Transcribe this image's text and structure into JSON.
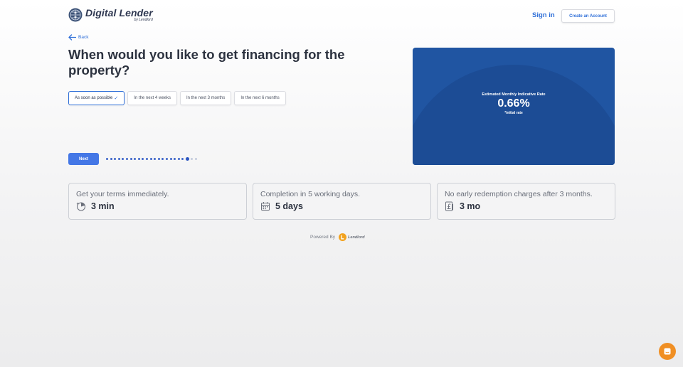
{
  "header": {
    "brand_title": "Digital Lender",
    "brand_sub": "by Lendlord",
    "signin_label": "Sign in",
    "create_account_label": "Create an Account"
  },
  "back_label": "Back",
  "question": "When would you like to get financing for the property?",
  "options": [
    {
      "label": "As soon as possible",
      "selected": true
    },
    {
      "label": "In the next 4 weeks",
      "selected": false
    },
    {
      "label": "In the next 3 months",
      "selected": false
    },
    {
      "label": "In the next 6 months",
      "selected": false
    }
  ],
  "next_label": "Next",
  "progress": {
    "total": 23,
    "current": 21
  },
  "rate_panel": {
    "label": "Estimated Monthly Indicative Rate",
    "value": "0.66%",
    "note": "*initial rate"
  },
  "cards": [
    {
      "title": "Get your terms immediately.",
      "value": "3 min",
      "icon": "timer-icon"
    },
    {
      "title": "Completion in 5 working days.",
      "value": "5 days",
      "icon": "calendar-icon"
    },
    {
      "title": "No early redemption charges after 3 months.",
      "value": "3 mo",
      "icon": "pound-document-icon"
    }
  ],
  "powered_by": {
    "label": "Powered By",
    "brand": "Lendlord"
  },
  "colors": {
    "accent": "#2f6fd8",
    "button": "#4477e6",
    "panel": "#2055a2",
    "chat": "#f08f24"
  }
}
